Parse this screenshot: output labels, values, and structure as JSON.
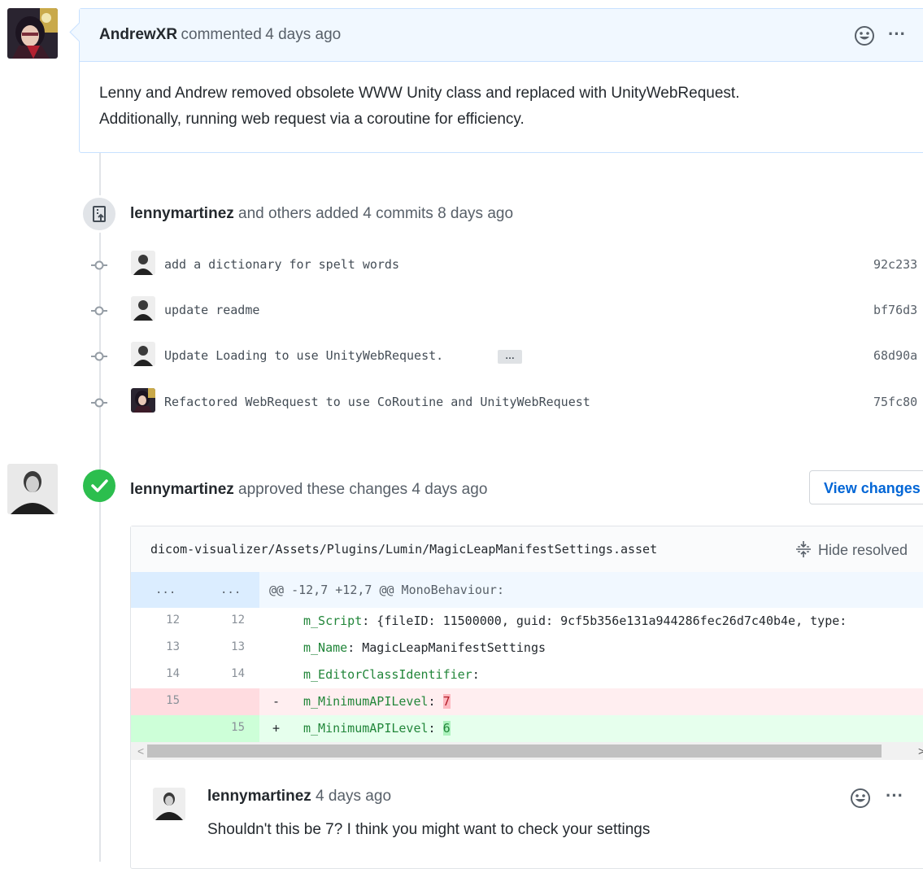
{
  "comment1": {
    "author": "AndrewXR",
    "action": "commented",
    "time": "4 days ago",
    "body_line1": "Lenny and Andrew removed obsolete WWW Unity class and replaced with UnityWebRequest.",
    "body_line2": "Additionally, running web request via a coroutine for efficiency."
  },
  "commits_event": {
    "author": "lennymartinez",
    "text": "and others added 4 commits 8 days ago",
    "commits": [
      {
        "message": "add a dictionary for spelt words",
        "sha": "92c233"
      },
      {
        "message": "update readme",
        "sha": "bf76d3"
      },
      {
        "message": "Update Loading to use UnityWebRequest.",
        "sha": "68d90a",
        "more": "…"
      },
      {
        "message": "Refactored WebRequest to use CoRoutine and UnityWebRequest",
        "sha": "75fc80"
      }
    ]
  },
  "review": {
    "author": "lennymartinez",
    "text": "approved these changes 4 days ago",
    "view_changes": "View changes",
    "file_path": "dicom-visualizer/Assets/Plugins/Lumin/MagicLeapManifestSettings.asset",
    "hide_resolved": "Hide resolved",
    "hunk": {
      "left": "...",
      "right": "...",
      "text": "@@ -12,7 +12,7 @@ MonoBehaviour:"
    },
    "lines": [
      {
        "old": "12",
        "new": "12",
        "sign": "",
        "key": "m_Script",
        "value": ": {fileID: 11500000, guid: 9cf5b356e131a944286fec26d7c40b4e, type:"
      },
      {
        "old": "13",
        "new": "13",
        "sign": "",
        "key": "m_Name",
        "value": ": MagicLeapManifestSettings"
      },
      {
        "old": "14",
        "new": "14",
        "sign": "",
        "key": "m_EditorClassIdentifier",
        "value": ":"
      },
      {
        "old": "15",
        "new": "",
        "sign": "-",
        "key": "m_MinimumAPILevel",
        "value": ": ",
        "changed": "7"
      },
      {
        "old": "",
        "new": "15",
        "sign": "+",
        "key": "m_MinimumAPILevel",
        "value": ": ",
        "changed": "6"
      }
    ],
    "scroll_left": "<",
    "scroll_right": ">",
    "reply": {
      "author": "lennymartinez",
      "time": "4 days ago",
      "body": "Shouldn't this be 7? I think you might want to check your settings"
    }
  },
  "colors": {
    "header_bg": "#f1f8ff",
    "header_border": "#c8e1ff",
    "approved_green": "#2cbe4e",
    "deletion_bg": "#ffeef0",
    "deletion_num_bg": "#ffdce0",
    "addition_bg": "#e6ffed",
    "addition_num_bg": "#cdffd8",
    "hunk_bg": "#f1f8ff",
    "hunk_num_bg": "#dbedff",
    "link_blue": "#0366d6"
  }
}
